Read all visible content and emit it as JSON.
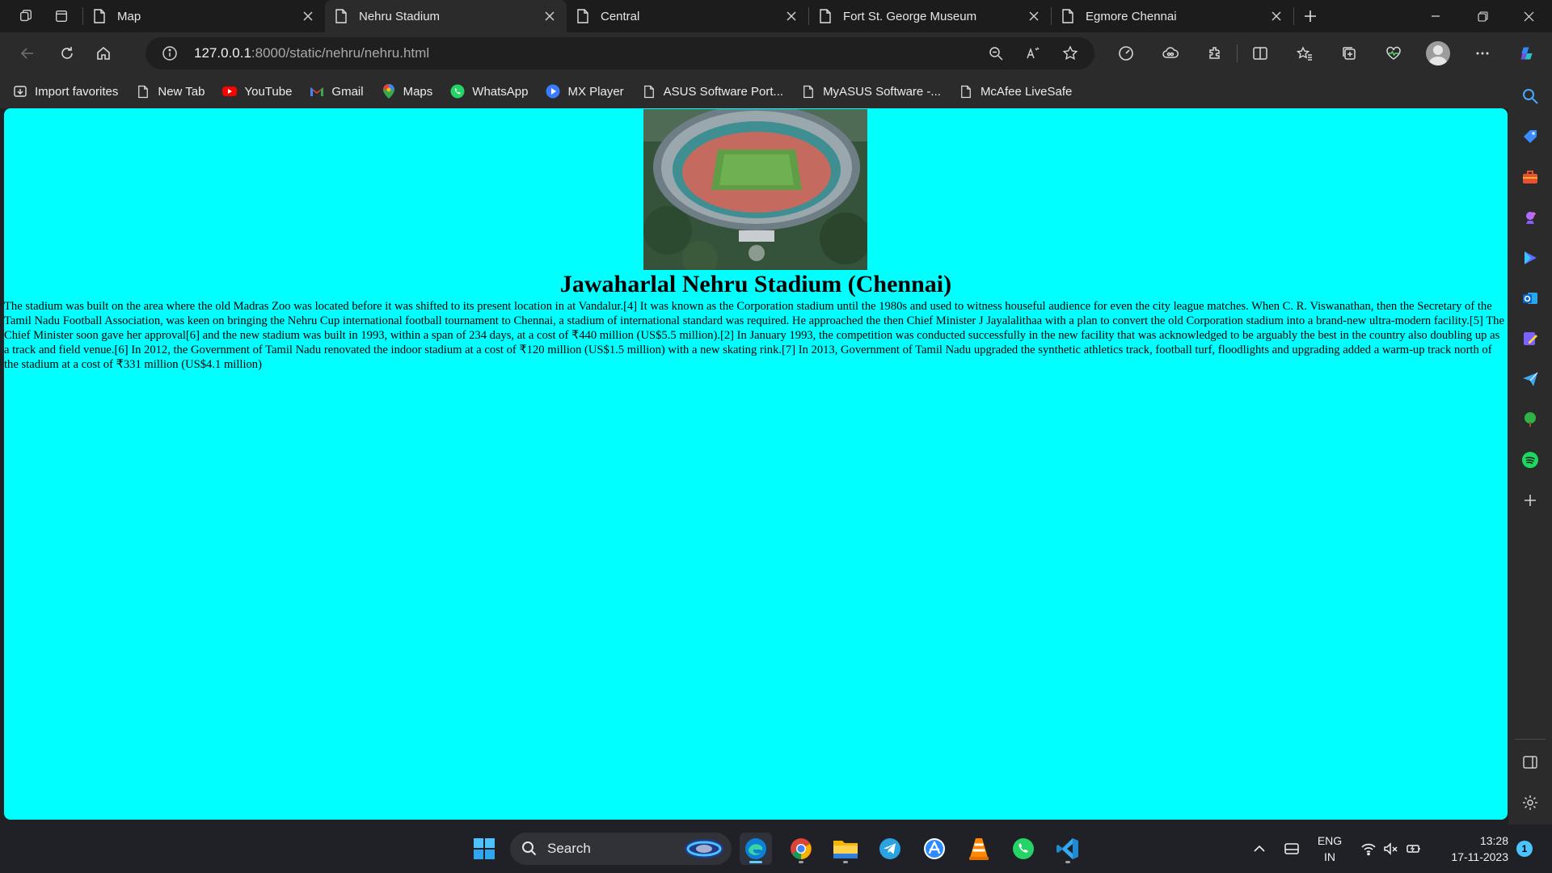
{
  "browser": {
    "tabs": [
      {
        "label": "Map",
        "active": false
      },
      {
        "label": "Nehru Stadium",
        "active": true
      },
      {
        "label": "Central",
        "active": false
      },
      {
        "label": "Fort St. George Museum",
        "active": false
      },
      {
        "label": "Egmore Chennai",
        "active": false
      }
    ],
    "address": {
      "host": "127.0.0.1",
      "path": ":8000/static/nehru/nehru.html"
    },
    "favorites": [
      {
        "label": "Import favorites",
        "icon": "import-icon"
      },
      {
        "label": "New Tab",
        "icon": "page-icon"
      },
      {
        "label": "YouTube",
        "icon": "youtube-icon"
      },
      {
        "label": "Gmail",
        "icon": "gmail-icon"
      },
      {
        "label": "Maps",
        "icon": "maps-pin-icon"
      },
      {
        "label": "WhatsApp",
        "icon": "whatsapp-icon"
      },
      {
        "label": "MX Player",
        "icon": "mx-player-icon"
      },
      {
        "label": "ASUS Software Port...",
        "icon": "page-icon"
      },
      {
        "label": "MyASUS Software -...",
        "icon": "page-icon"
      },
      {
        "label": "McAfee LiveSafe",
        "icon": "page-icon"
      }
    ]
  },
  "page": {
    "title": "Jawaharlal Nehru Stadium (Chennai)",
    "body": "The stadium was built on the area where the old Madras Zoo was located before it was shifted to its present location in at Vandalur.[4] It was known as the Corporation stadium until the 1980s and used to witness houseful audience for even the city league matches. When C. R. Viswanathan, then the Secretary of the Tamil Nadu Football Association, was keen on bringing the Nehru Cup international football tournament to Chennai, a stadium of international standard was required. He approached the then Chief Minister J Jayalalithaa with a plan to convert the old Corporation stadium into a brand-new ultra-modern facility.[5] The Chief Minister soon gave her approval[6] and the new stadium was built in 1993, within a span of 234 days, at a cost of ₹440 million (US$5.5 million).[2] In January 1993, the competition was conducted successfully in the new facility that was acknowledged to be arguably the best in the country also doubling up as a track and field venue.[6] In 2012, the Government of Tamil Nadu renovated the indoor stadium at a cost of ₹120 million (US$1.5 million) with a new skating rink.[7] In 2013, Government of Tamil Nadu upgraded the synthetic athletics track, football turf, floodlights and upgrading added a warm-up track north of the stadium at a cost of ₹331 million (US$4.1 million)",
    "background": "#00ffff"
  },
  "taskbar": {
    "search_label": "Search",
    "lang_top": "ENG",
    "lang_bottom": "IN",
    "time": "13:28",
    "date": "17-11-2023",
    "notification_count": "1"
  }
}
